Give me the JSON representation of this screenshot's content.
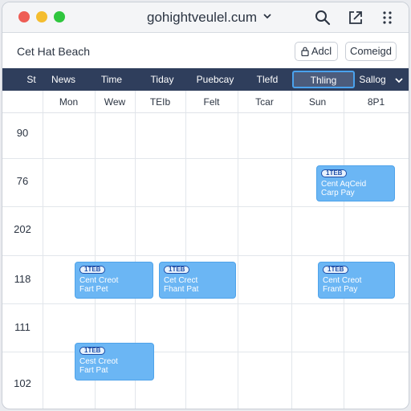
{
  "window": {
    "url": "gohightveulel.cum"
  },
  "toolbar": {
    "title": "Cet Hat Beach",
    "add_label": "Adcl",
    "config_label": "Comeigd"
  },
  "nav": {
    "items": [
      {
        "label": "St"
      },
      {
        "label": "News"
      },
      {
        "label": "Time"
      },
      {
        "label": "Tiday"
      },
      {
        "label": "Puebcay"
      },
      {
        "label": "Tlefd"
      },
      {
        "label": "Thling"
      },
      {
        "label": "Sallog"
      }
    ],
    "active_index": 6
  },
  "calendar": {
    "days": [
      "Mon",
      "Wew",
      "TEIb",
      "Felt",
      "Tcar",
      "Sun",
      "8P1"
    ],
    "hours": [
      "90",
      "76",
      "202",
      "118",
      "111",
      "102"
    ],
    "events": [
      {
        "badge": "1TEB",
        "line1": "Cent AqCeid",
        "line2": "Carp Pay"
      },
      {
        "badge": "1TEB",
        "line1": "Cent Creot",
        "line2": "Fart Pet"
      },
      {
        "badge": "1TEB",
        "line1": "Cet Crect",
        "line2": "Fhant Pat"
      },
      {
        "badge": "1TEB",
        "line1": "Cent Creot",
        "line2": "Frant Pay"
      },
      {
        "badge": "1TEB",
        "line1": "Cest Creot",
        "line2": "Fart Pat"
      }
    ]
  },
  "colors": {
    "navbar": "#2f3e5c",
    "event_fill": "#6bb6f4",
    "active_outline": "#4aa2ee"
  }
}
